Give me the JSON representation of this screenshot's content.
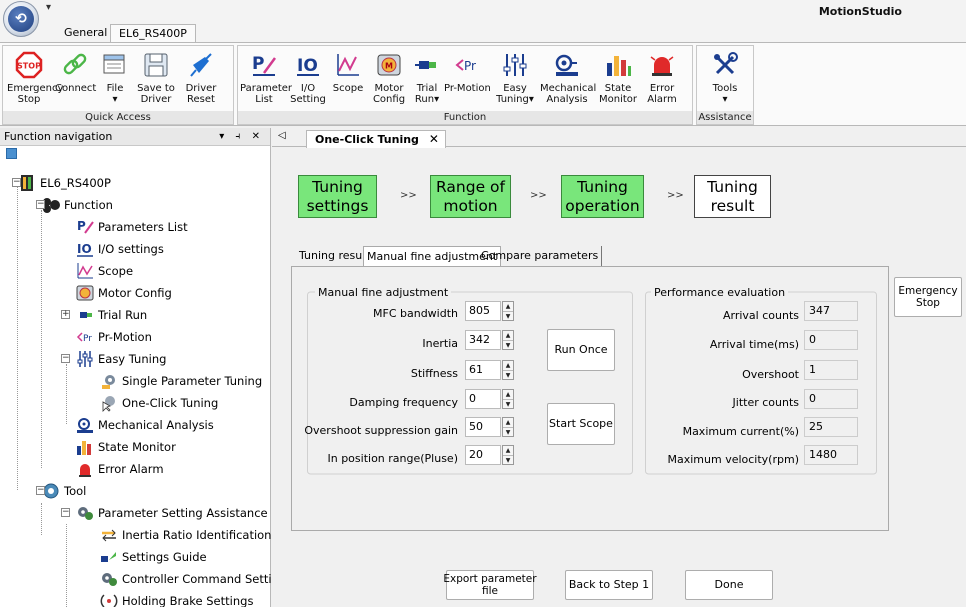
{
  "app": {
    "title": "MotionStudio",
    "logo": "app-orb-icon"
  },
  "ribbon_tabs": [
    {
      "label": "General"
    },
    {
      "label": "EL6_RS400P"
    }
  ],
  "ribbon": {
    "groups": [
      {
        "label": "Quick Access"
      },
      {
        "label": "Function"
      },
      {
        "label": "Assistance"
      }
    ],
    "buttons": [
      {
        "label": "Emergency\nStop",
        "icon": "stop-sign-icon"
      },
      {
        "label": "Connect",
        "icon": "chain-link-icon"
      },
      {
        "label": "File\n▾",
        "icon": "file-icon"
      },
      {
        "label": "Save to\nDriver",
        "icon": "floppy-disk-icon"
      },
      {
        "label": "Driver\nReset",
        "icon": "reset-plug-icon"
      },
      {
        "label": "Parameter\nList",
        "icon": "parameter-list-icon"
      },
      {
        "label": "I/O\nSetting",
        "icon": "io-setting-icon"
      },
      {
        "label": "Scope",
        "icon": "scope-icon"
      },
      {
        "label": "Motor\nConfig",
        "icon": "motor-config-icon"
      },
      {
        "label": "Trial\nRun▾",
        "icon": "trial-run-icon"
      },
      {
        "label": "Pr-Motion",
        "icon": "pr-motion-icon"
      },
      {
        "label": "Easy\nTuning▾",
        "icon": "easy-tuning-icon"
      },
      {
        "label": "Mechanical\nAnalysis",
        "icon": "mechanical-analysis-icon"
      },
      {
        "label": "State\nMonitor",
        "icon": "state-monitor-icon"
      },
      {
        "label": "Error\nAlarm",
        "icon": "error-alarm-icon"
      },
      {
        "label": "Tools\n▾",
        "icon": "tools-icon"
      }
    ]
  },
  "nav": {
    "title": "Function navigation",
    "controls": "▾ ⫞ ✕",
    "items": [
      {
        "label": "EL6_RS400P",
        "icon": "device-icon"
      },
      {
        "label": "Function",
        "icon": "function-icon"
      },
      {
        "label": "Parameters List",
        "icon": "parameter-list-icon"
      },
      {
        "label": "I/O settings",
        "icon": "io-setting-icon"
      },
      {
        "label": "Scope",
        "icon": "scope-icon"
      },
      {
        "label": "Motor Config",
        "icon": "motor-config-icon"
      },
      {
        "label": "Trial Run",
        "icon": "trial-run-icon"
      },
      {
        "label": "Pr-Motion",
        "icon": "pr-motion-icon"
      },
      {
        "label": "Easy Tuning",
        "icon": "easy-tuning-icon"
      },
      {
        "label": "Single Parameter Tuning",
        "icon": "single-tuning-icon"
      },
      {
        "label": "One-Click Tuning",
        "icon": "one-click-tuning-icon"
      },
      {
        "label": "Mechanical Analysis",
        "icon": "mechanical-analysis-icon"
      },
      {
        "label": "State Monitor",
        "icon": "state-monitor-icon"
      },
      {
        "label": "Error Alarm",
        "icon": "error-alarm-icon"
      },
      {
        "label": "Tool",
        "icon": "tool-icon"
      },
      {
        "label": "Parameter Setting Assistance",
        "icon": "gear-assist-icon"
      },
      {
        "label": "Inertia Ratio Identification",
        "icon": "inertia-icon"
      },
      {
        "label": "Settings Guide",
        "icon": "settings-guide-icon"
      },
      {
        "label": "Controller Command Settir",
        "icon": "controller-command-icon"
      },
      {
        "label": "Holding Brake Settings",
        "icon": "holding-brake-icon"
      }
    ]
  },
  "doc_tab": {
    "label": "One-Click Tuning",
    "close": "✕",
    "scroll_left": "◁"
  },
  "steps": [
    {
      "label": "Tuning\nsettings",
      "state": "done"
    },
    {
      "label": "Range of\nmotion",
      "state": "done"
    },
    {
      "label": "Tuning\noperation",
      "state": "done"
    },
    {
      "label": "Tuning\nresult",
      "state": "current"
    }
  ],
  "step_separator": ">>",
  "subtabs": [
    {
      "label": "Tuning result"
    },
    {
      "label": "Manual fine adjustment"
    },
    {
      "label": "Compare parameters"
    }
  ],
  "manual": {
    "title": "Manual fine adjustment",
    "fields": [
      {
        "label": "MFC bandwidth",
        "value": "805"
      },
      {
        "label": "Inertia",
        "value": "342"
      },
      {
        "label": "Stiffness",
        "value": "61"
      },
      {
        "label": "Damping frequency",
        "value": "0"
      },
      {
        "label": "Overshoot suppression gain",
        "value": "50"
      },
      {
        "label": "In position range(Pluse)",
        "value": "20"
      }
    ],
    "run_once": "Run Once",
    "start_scope": "Start Scope"
  },
  "performance": {
    "title": "Performance evaluation",
    "rows": [
      {
        "label": "Arrival counts",
        "value": "347"
      },
      {
        "label": "Arrival time(ms)",
        "value": "0"
      },
      {
        "label": "Overshoot",
        "value": "1"
      },
      {
        "label": "Jitter counts",
        "value": "0"
      },
      {
        "label": "Maximum current(%)",
        "value": "25"
      },
      {
        "label": "Maximum velocity(rpm)",
        "value": "1480"
      }
    ]
  },
  "emergency_stop": "Emergency\nStop",
  "footer": {
    "export": "Export parameter\nfile",
    "back": "Back to Step 1",
    "done": "Done"
  }
}
